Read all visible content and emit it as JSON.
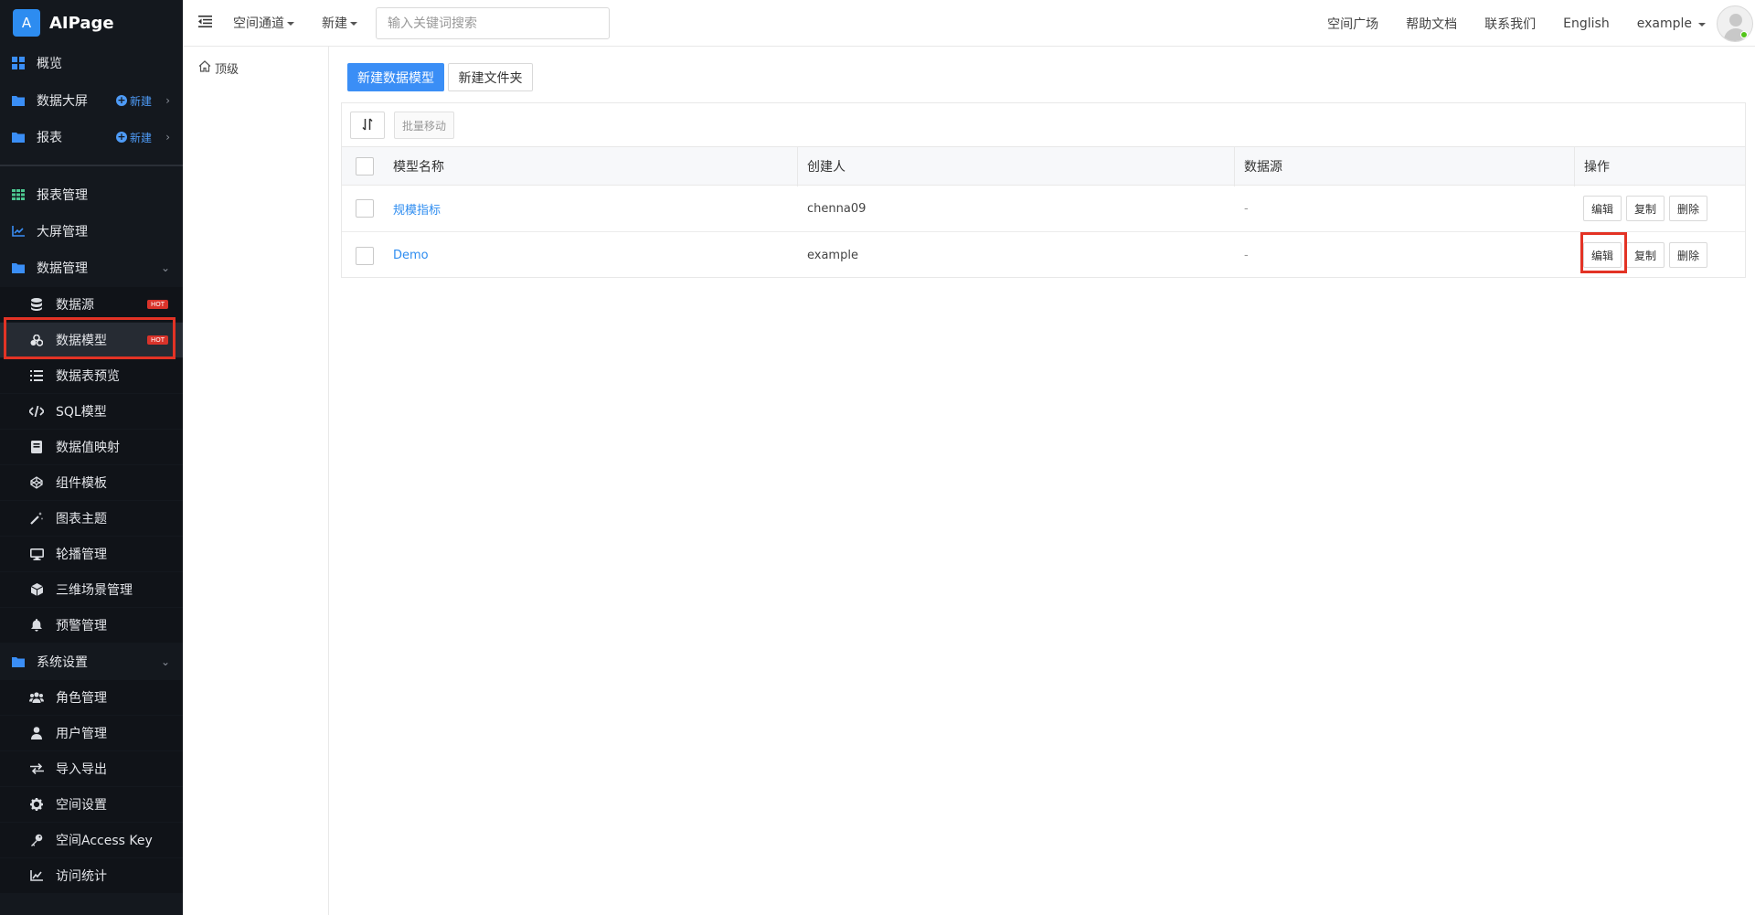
{
  "sidebar": {
    "logo_letter": "A",
    "logo_text": "AIPage",
    "items": [
      {
        "label": "概览",
        "icon": "grid-icon"
      },
      {
        "label": "数据大屏",
        "icon": "folder-icon",
        "new_label": "新建"
      },
      {
        "label": "报表",
        "icon": "folder-icon",
        "new_label": "新建"
      },
      {
        "label": "报表管理",
        "icon": "table-icon"
      },
      {
        "label": "大屏管理",
        "icon": "chart-line-icon"
      },
      {
        "label": "数据管理",
        "icon": "folder-icon"
      },
      {
        "label": "数据源",
        "icon": "database-icon",
        "badge": "HOT"
      },
      {
        "label": "数据模型",
        "icon": "cubes-icon",
        "badge": "HOT"
      },
      {
        "label": "数据表预览",
        "icon": "list-icon"
      },
      {
        "label": "SQL模型",
        "icon": "code-icon"
      },
      {
        "label": "数据值映射",
        "icon": "book-icon"
      },
      {
        "label": "组件模板",
        "icon": "codepen-icon"
      },
      {
        "label": "图表主题",
        "icon": "magic-wand-icon"
      },
      {
        "label": "轮播管理",
        "icon": "monitor-icon"
      },
      {
        "label": "三维场景管理",
        "icon": "cube-icon"
      },
      {
        "label": "预警管理",
        "icon": "bell-icon"
      },
      {
        "label": "系统设置",
        "icon": "folder-icon"
      },
      {
        "label": "角色管理",
        "icon": "users-icon"
      },
      {
        "label": "用户管理",
        "icon": "user-icon"
      },
      {
        "label": "导入导出",
        "icon": "exchange-icon"
      },
      {
        "label": "空间设置",
        "icon": "gear-icon"
      },
      {
        "label": "空间Access Key",
        "icon": "key-icon"
      },
      {
        "label": "访问统计",
        "icon": "chart-area-icon"
      }
    ]
  },
  "topbar": {
    "space_channel": "空间通道",
    "new": "新建",
    "search_placeholder": "输入关键词搜索",
    "links": [
      "空间广场",
      "帮助文档",
      "联系我们",
      "English"
    ],
    "user": "example"
  },
  "folder": {
    "root_label": "顶级"
  },
  "toolbar": {
    "new_model": "新建数据模型",
    "new_folder": "新建文件夹",
    "batch_move": "批量移动"
  },
  "table": {
    "columns": [
      "模型名称",
      "创建人",
      "数据源",
      "操作"
    ],
    "rows": [
      {
        "name": "规模指标",
        "creator": "chenna09",
        "source": "-"
      },
      {
        "name": "Demo",
        "creator": "example",
        "source": "-"
      }
    ],
    "actions": [
      "编辑",
      "复制",
      "删除"
    ]
  },
  "colors": {
    "accent": "#3a8ef6",
    "sidebar_bg": "#14181e",
    "highlight": "#e33325",
    "hot_badge": "#d9332a"
  }
}
